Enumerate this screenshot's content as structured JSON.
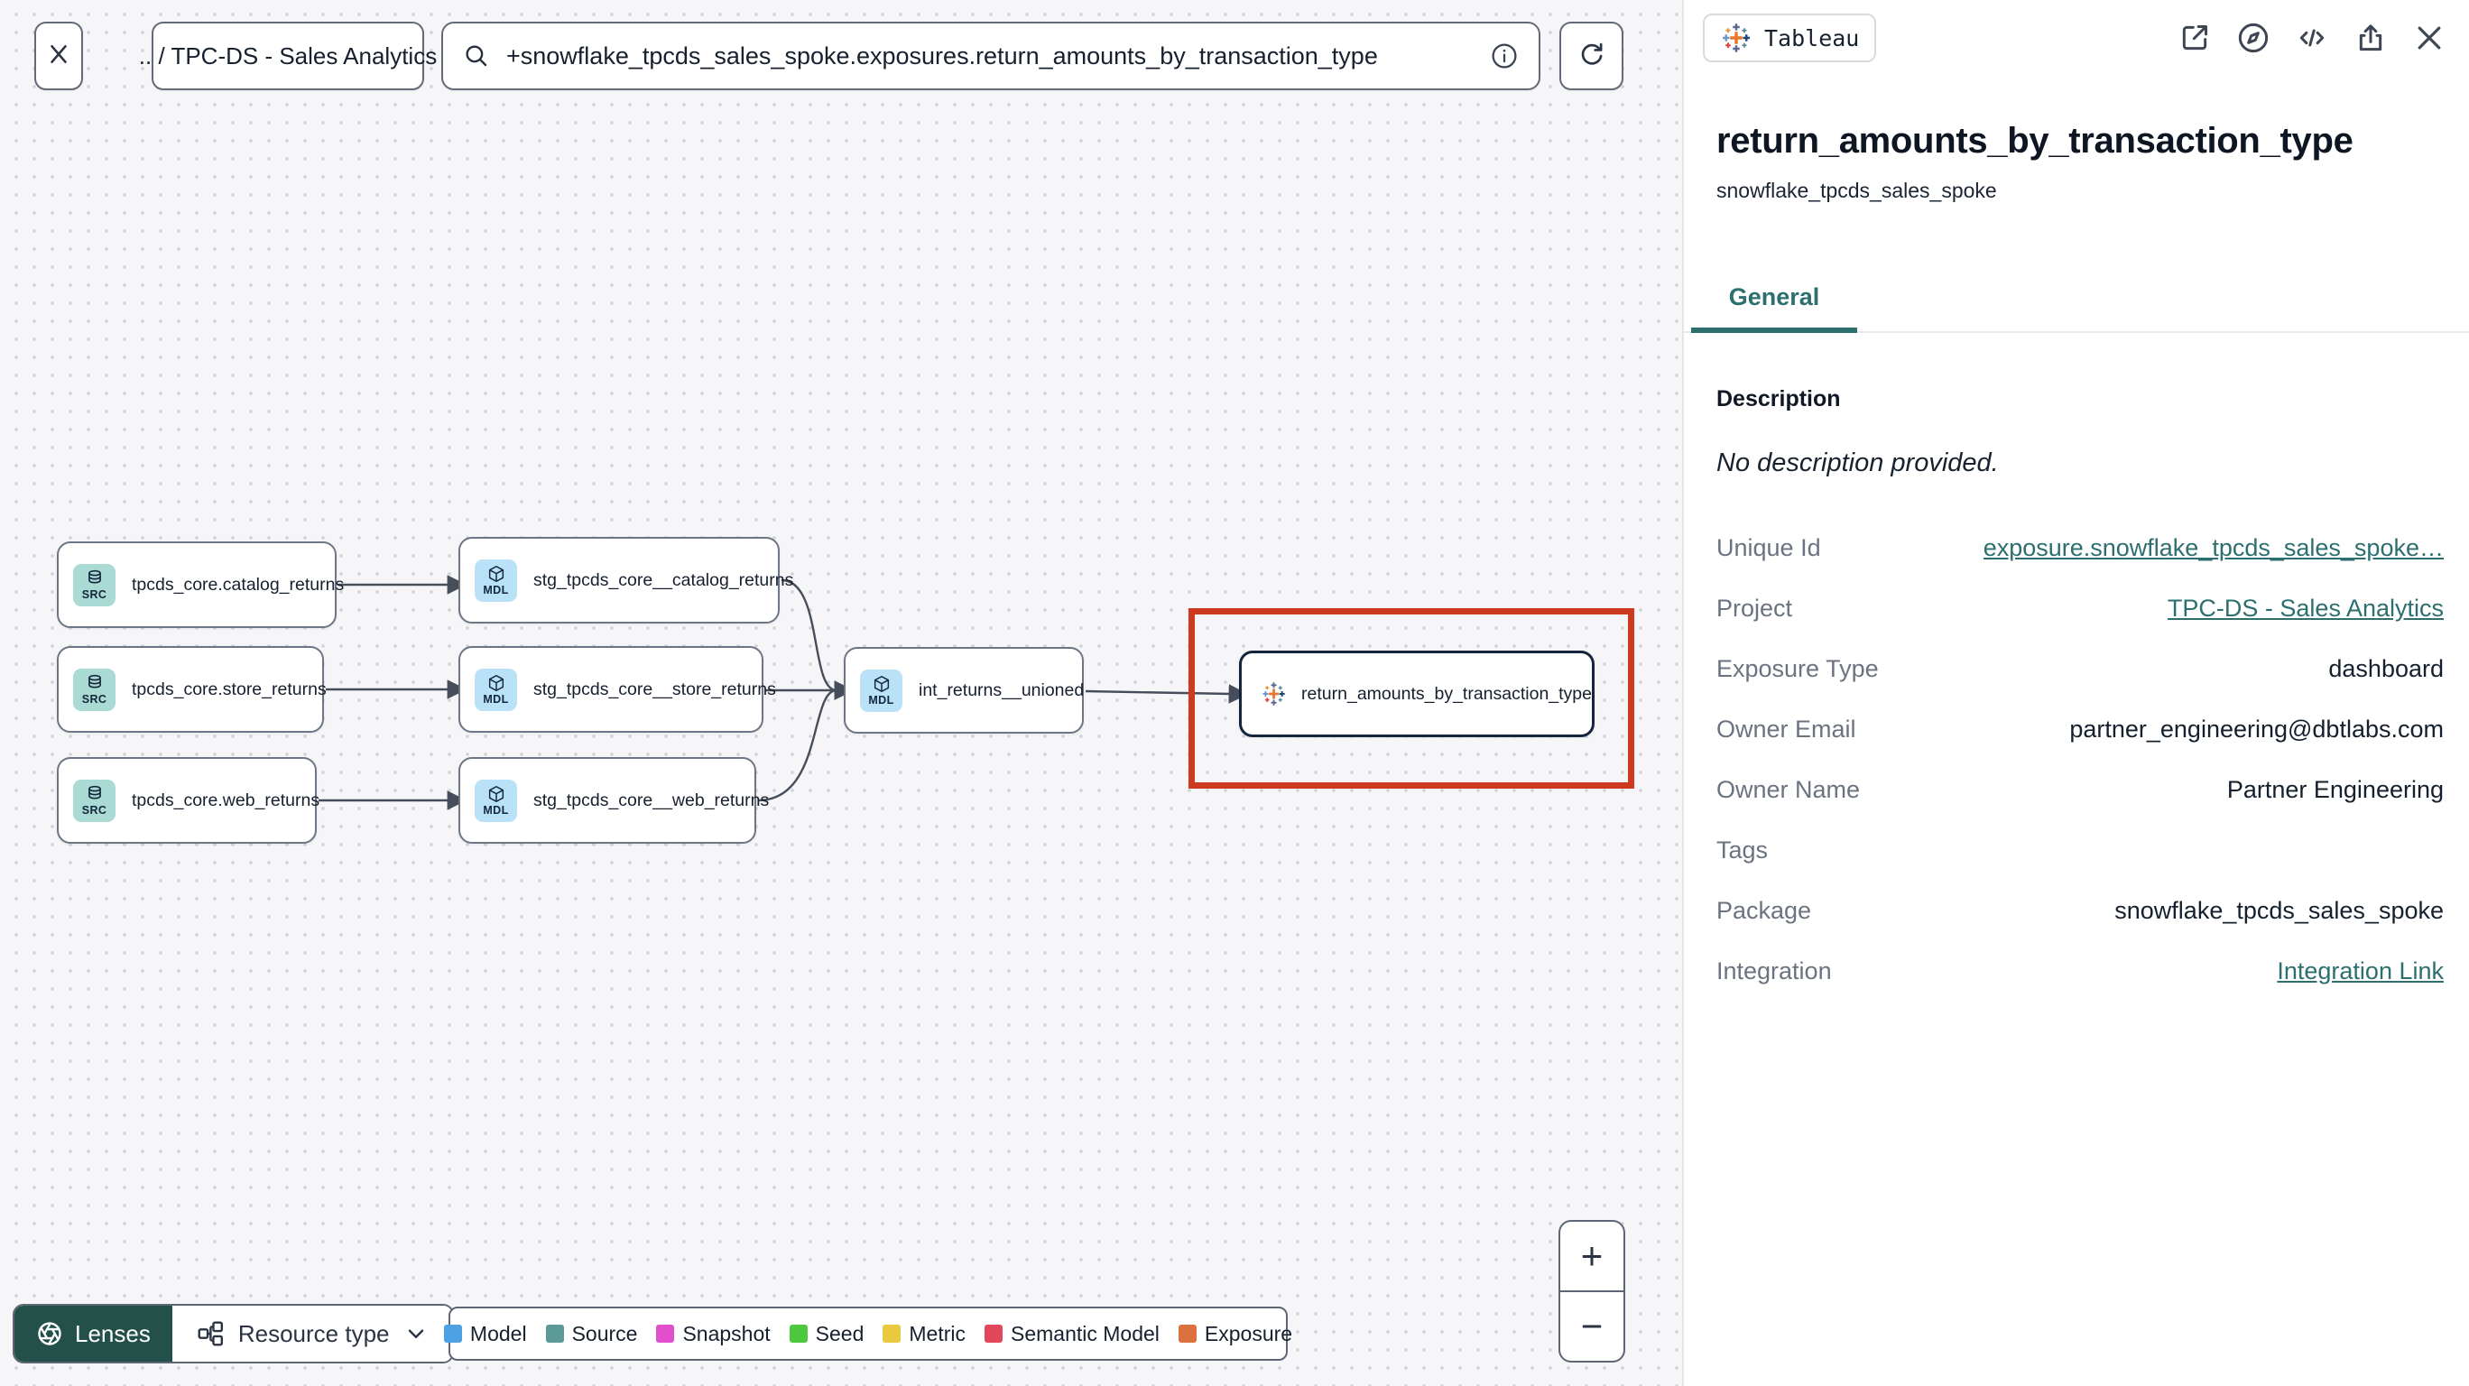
{
  "topbar": {
    "breadcrumb": ".. / TPC-DS - Sales Analytics",
    "search_value": "+snowflake_tpcds_sales_spoke.exposures.return_amounts_by_transaction_type"
  },
  "graph": {
    "nodes": [
      {
        "id": "src_catalog",
        "type": "source",
        "badge": "SRC",
        "label": "tpcds_core.catalog_returns"
      },
      {
        "id": "src_store",
        "type": "source",
        "badge": "SRC",
        "label": "tpcds_core.store_returns"
      },
      {
        "id": "src_web",
        "type": "source",
        "badge": "SRC",
        "label": "tpcds_core.web_returns"
      },
      {
        "id": "stg_catalog",
        "type": "model",
        "badge": "MDL",
        "label": "stg_tpcds_core__catalog_returns"
      },
      {
        "id": "stg_store",
        "type": "model",
        "badge": "MDL",
        "label": "stg_tpcds_core__store_returns"
      },
      {
        "id": "stg_web",
        "type": "model",
        "badge": "MDL",
        "label": "stg_tpcds_core__web_returns"
      },
      {
        "id": "int_unioned",
        "type": "model",
        "badge": "MDL",
        "label": "int_returns__unioned"
      },
      {
        "id": "exposure",
        "type": "exposure",
        "badge": "",
        "label": "return_amounts_by_transaction_type"
      }
    ],
    "selected_node": "exposure"
  },
  "toolbar": {
    "lenses_label": "Lenses",
    "resource_type_label": "Resource type"
  },
  "legend": {
    "items": [
      {
        "label": "Model",
        "color": "#4da1e3"
      },
      {
        "label": "Source",
        "color": "#5b9a98"
      },
      {
        "label": "Snapshot",
        "color": "#e24fcd"
      },
      {
        "label": "Seed",
        "color": "#4ec83f"
      },
      {
        "label": "Metric",
        "color": "#e8c93f"
      },
      {
        "label": "Semantic Model",
        "color": "#e2485c"
      },
      {
        "label": "Exposure",
        "color": "#dc7140"
      }
    ]
  },
  "zoom_controls": {
    "zoom_in": "+",
    "zoom_out": "−"
  },
  "panel": {
    "integration_badge": "Tableau",
    "title": "return_amounts_by_transaction_type",
    "subtitle": "snowflake_tpcds_sales_spoke",
    "tab": "General",
    "description_header": "Description",
    "description_text": "No description provided.",
    "fields": [
      {
        "label": "Unique Id",
        "value": "exposure.snowflake_tpcds_sales_spoke…",
        "link": true
      },
      {
        "label": "Project",
        "value": "TPC-DS - Sales Analytics",
        "link": true
      },
      {
        "label": "Exposure Type",
        "value": "dashboard",
        "link": false
      },
      {
        "label": "Owner Email",
        "value": "partner_engineering@dbtlabs.com",
        "link": false
      },
      {
        "label": "Owner Name",
        "value": "Partner Engineering",
        "link": false
      },
      {
        "label": "Tags",
        "value": "",
        "link": false
      },
      {
        "label": "Package",
        "value": "snowflake_tpcds_sales_spoke",
        "link": false
      },
      {
        "label": "Integration",
        "value": "Integration Link",
        "link": true
      }
    ]
  },
  "colors": {
    "accent_teal": "#2d6e6f",
    "selection_highlight": "#ce3a20",
    "lenses_button": "#235149"
  }
}
